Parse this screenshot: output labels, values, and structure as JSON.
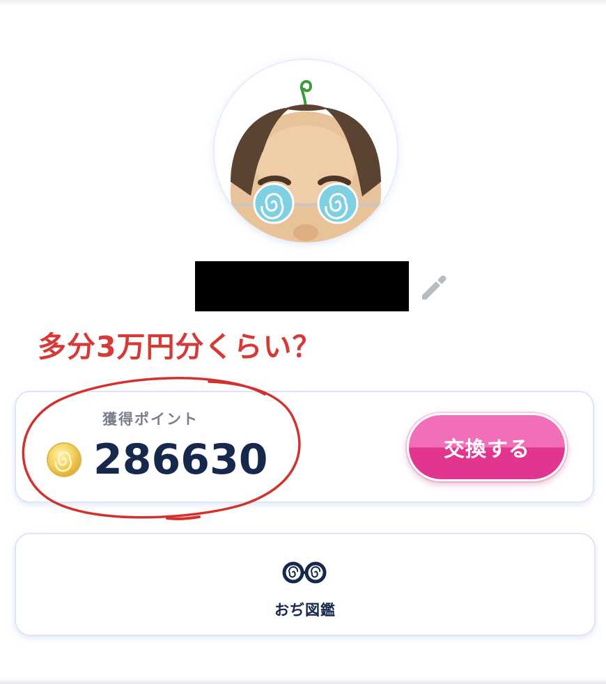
{
  "profile": {
    "avatar_icon": "avatar-character-with-spiral-glasses-icon",
    "name_redacted": true,
    "edit_icon": "pencil-icon"
  },
  "annotation": {
    "note": "多分3万円分くらい？",
    "note_color": "#d63a36"
  },
  "points": {
    "label": "獲得ポイント",
    "value": "286630",
    "coin_icon": "coin-icon",
    "value_color": "#17284d"
  },
  "exchange": {
    "label": "交換する",
    "color_top": "#f06fb8",
    "color_bottom": "#e2358f"
  },
  "encyclopedia": {
    "icon": "glasses-icon",
    "label": "おぢ図鑑"
  }
}
